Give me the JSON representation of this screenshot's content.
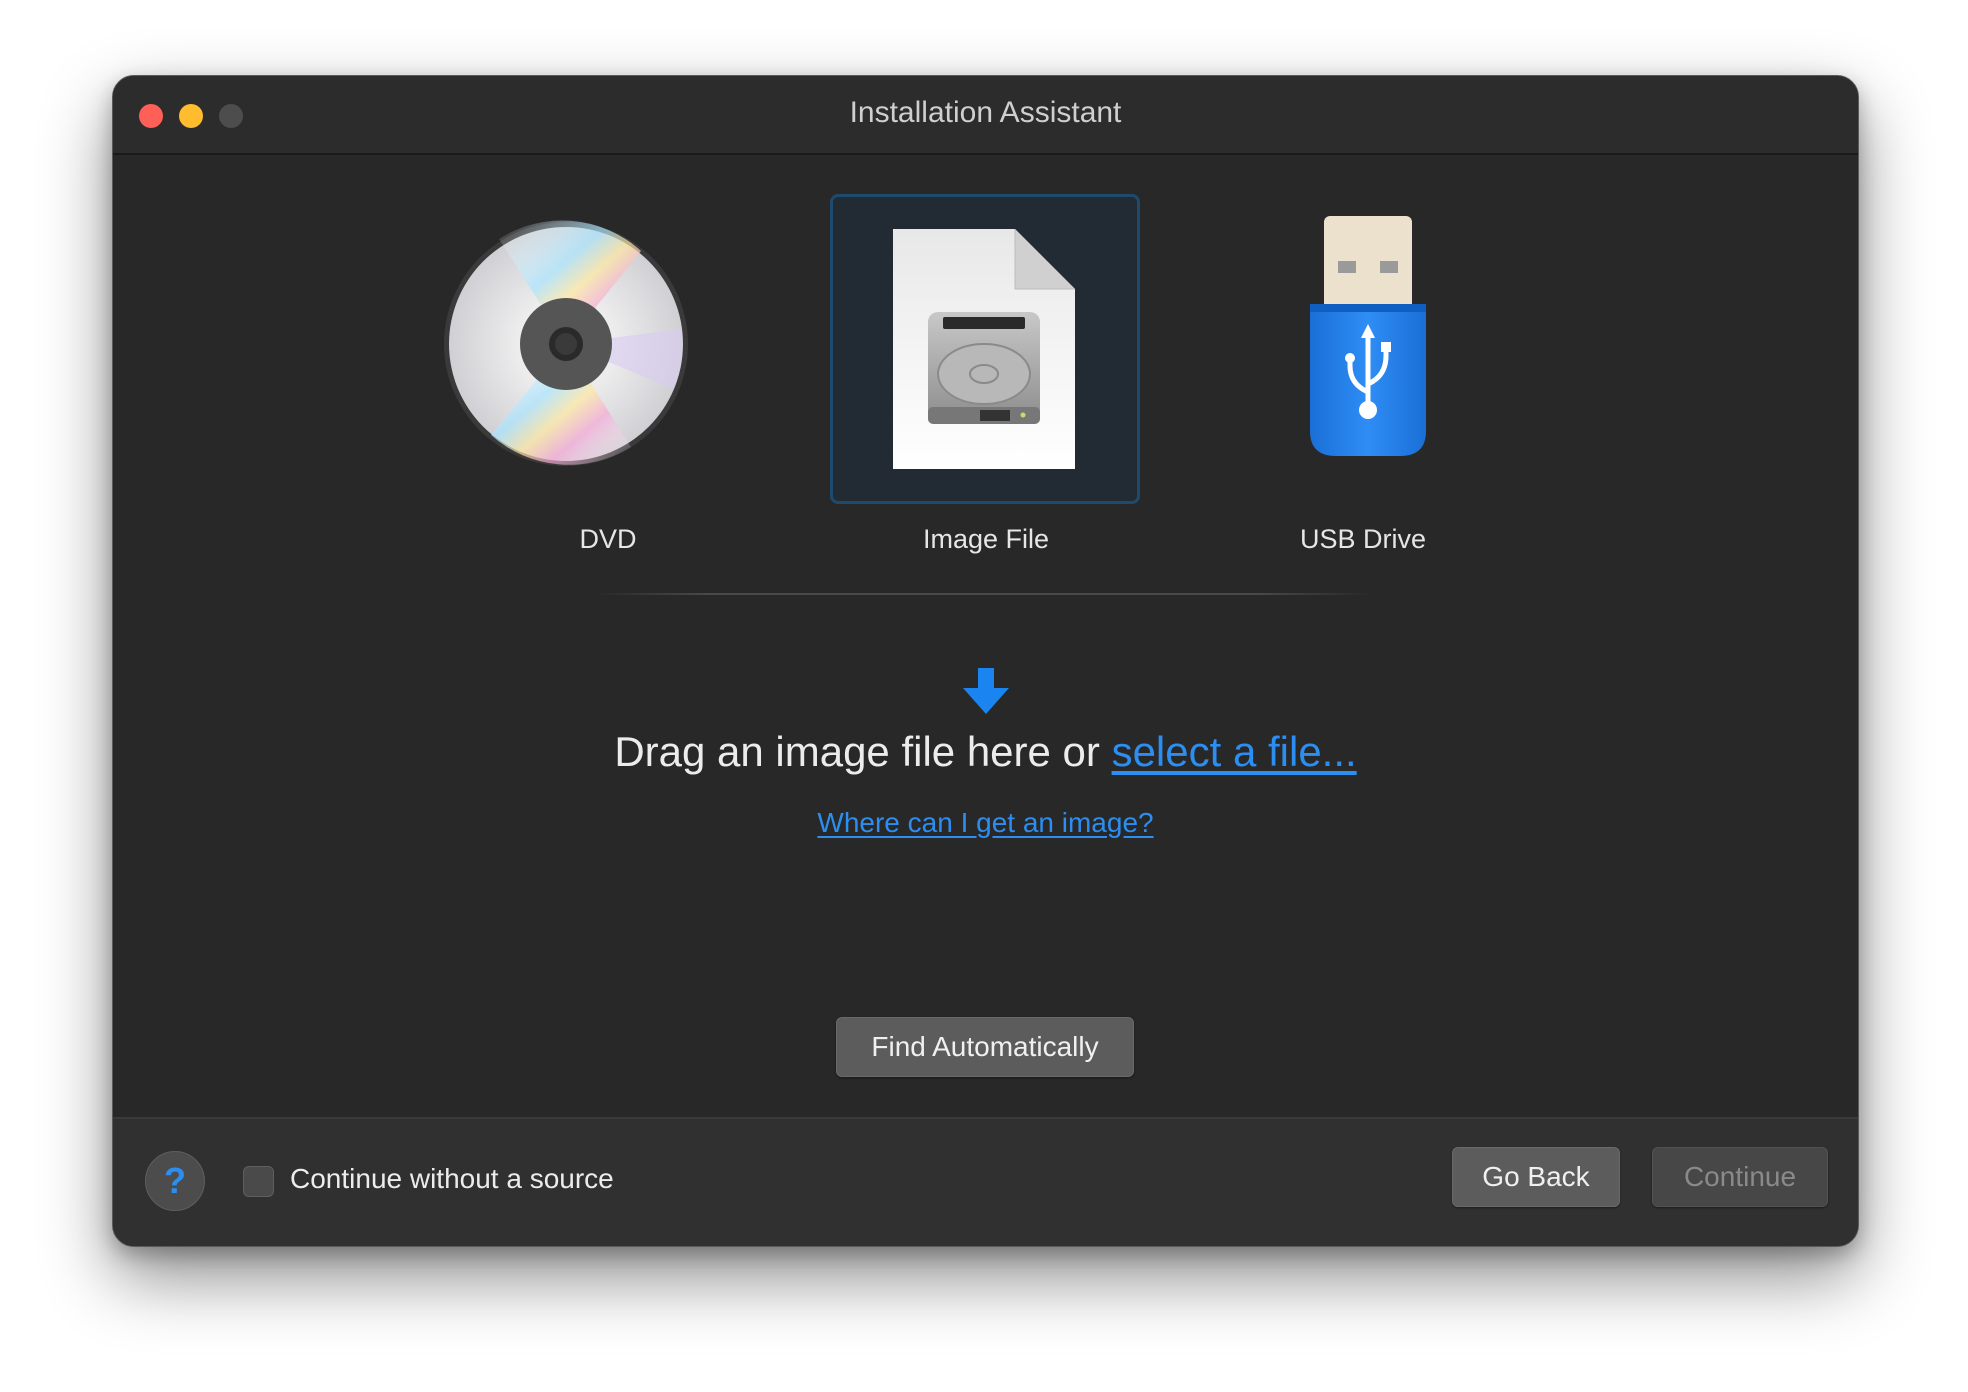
{
  "window": {
    "title": "Installation Assistant"
  },
  "sources": [
    {
      "label": "DVD",
      "icon": "dvd-disc-icon",
      "selected": false
    },
    {
      "label": "Image File",
      "icon": "disk-image-file-icon",
      "selected": true
    },
    {
      "label": "USB Drive",
      "icon": "usb-drive-icon",
      "selected": false
    }
  ],
  "drop_zone": {
    "text": "Drag an image file here or ",
    "link": "select a file...",
    "help_link": "Where can I get an image?"
  },
  "buttons": {
    "find_automatically": "Find Automatically",
    "help": "?",
    "go_back": "Go Back",
    "continue": "Continue"
  },
  "footer": {
    "checkbox_label": "Continue without a source",
    "checkbox_checked": false
  },
  "colors": {
    "accent": "#2b8ef0",
    "window_bg": "#282828",
    "selected_border": "#1e4a6e"
  }
}
